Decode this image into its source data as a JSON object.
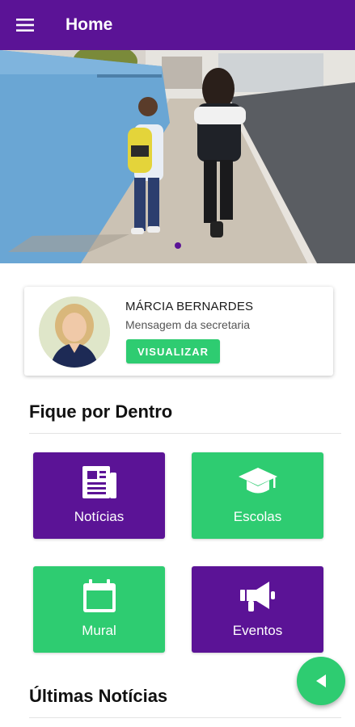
{
  "appbar": {
    "title": "Home",
    "menu_icon": "menu-icon"
  },
  "carousel": {
    "slide_count": 1,
    "active_index": 0
  },
  "profile": {
    "name": "MÁRCIA BERNARDES",
    "role": "Mensagem da secretaria",
    "button_label": "VISUALIZAR"
  },
  "section_inside": {
    "title": "Fique por Dentro"
  },
  "tiles": [
    {
      "label": "Notícias",
      "icon": "newspaper-icon",
      "color": "#5b1396"
    },
    {
      "label": "Escolas",
      "icon": "graduation-cap-icon",
      "color": "#2ecc71"
    },
    {
      "label": "Mural",
      "icon": "calendar-icon",
      "color": "#2ecc71"
    },
    {
      "label": "Eventos",
      "icon": "megaphone-icon",
      "color": "#5b1396"
    }
  ],
  "section_news": {
    "title": "Últimas Notícias"
  },
  "fab": {
    "icon": "play-left-icon"
  },
  "colors": {
    "primary": "#5b1396",
    "accent": "#2ecc71"
  }
}
